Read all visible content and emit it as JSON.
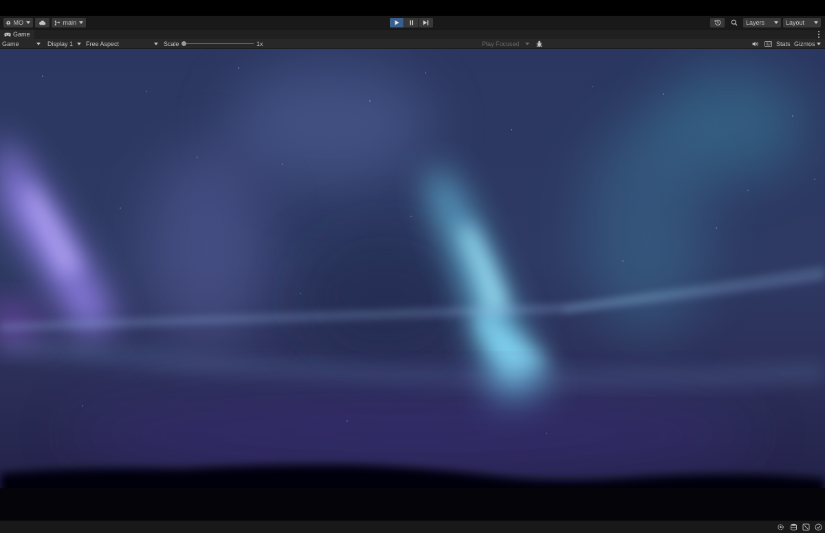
{
  "toolbar": {
    "account_label": "MO",
    "branch_label": "main",
    "layers_label": "Layers",
    "layout_label": "Layout"
  },
  "tab": {
    "title": "Game"
  },
  "gamebar": {
    "mode_select": "Game",
    "display_select": "Display 1",
    "aspect_select": "Free Aspect",
    "scale_label": "Scale",
    "scale_value": 1,
    "scale_value_label": "1x",
    "play_mode_select": "Play Focused",
    "stats_label": "Stats",
    "gizmos_label": "Gizmos"
  },
  "colors": {
    "play_active": "#3a5f8c",
    "toolbar_bg": "#191919",
    "panel_bg": "#282828",
    "aurora_cyan": "#7fd6f5",
    "aurora_violet": "#a58cff",
    "sky": "#2b3760",
    "ground": "#06050d"
  },
  "icons": {
    "account": "account-icon",
    "cloud": "cloud-icon",
    "branch": "branch-icon",
    "play": "play-icon",
    "pause": "pause-icon",
    "step": "step-icon",
    "history": "history-icon",
    "search": "search-icon",
    "game_tab": "gamepad-icon",
    "debug": "bug-icon",
    "audio": "speaker-icon",
    "keyboard": "keyboard-icon"
  }
}
